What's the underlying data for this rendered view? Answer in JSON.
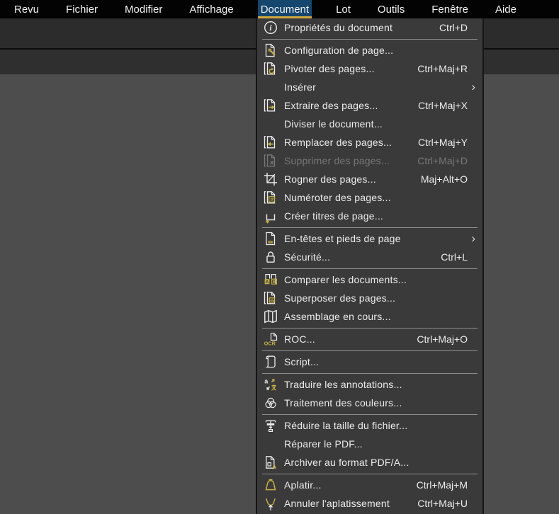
{
  "colors": {
    "menubar_bg": "#030303",
    "active_tab_bg": "#15466e",
    "underline_gold": "#cfa93c",
    "icon_accent": "#c9b041",
    "panel_bg": "#3a3a3a",
    "workspace_bg": "#4d4d4d",
    "text": "#ececec",
    "disabled_text": "#777777",
    "separator": "#8d8d8d"
  },
  "menubar": {
    "items": [
      {
        "label": "Revu"
      },
      {
        "label": "Fichier"
      },
      {
        "label": "Modifier"
      },
      {
        "label": "Affichage"
      },
      {
        "label": "Document",
        "active": true
      },
      {
        "label": "Lot"
      },
      {
        "label": "Outils"
      },
      {
        "label": "Fenêtre"
      },
      {
        "label": "Aide"
      }
    ]
  },
  "dropdown": {
    "owner": "Document",
    "groups": [
      {
        "items": [
          {
            "label": "Propriétés du document",
            "icon": "info-icon",
            "shortcut": "Ctrl+D"
          }
        ]
      },
      {
        "items": [
          {
            "label": "Configuration de page...",
            "icon": "page-setup-icon"
          },
          {
            "label": "Pivoter des pages...",
            "icon": "rotate-pages-icon",
            "shortcut": "Ctrl+Maj+R"
          },
          {
            "label": "Insérer",
            "submenu": true
          },
          {
            "label": "Extraire des pages...",
            "icon": "extract-pages-icon",
            "shortcut": "Ctrl+Maj+X"
          },
          {
            "label": "Diviser le document..."
          },
          {
            "label": "Remplacer des pages...",
            "icon": "replace-pages-icon",
            "shortcut": "Ctrl+Maj+Y"
          },
          {
            "label": "Supprimer des pages...",
            "icon": "delete-pages-icon",
            "shortcut": "Ctrl+Maj+D",
            "disabled": true
          },
          {
            "label": "Rogner des pages...",
            "icon": "crop-pages-icon",
            "shortcut": "Maj+Alt+O"
          },
          {
            "label": "Numéroter des pages...",
            "icon": "number-pages-icon"
          },
          {
            "label": "Créer titres de page...",
            "icon": "page-labels-icon"
          }
        ]
      },
      {
        "items": [
          {
            "label": "En-têtes et pieds de page",
            "icon": "header-footer-icon",
            "submenu": true
          },
          {
            "label": "Sécurité...",
            "icon": "lock-icon",
            "shortcut": "Ctrl+L"
          }
        ]
      },
      {
        "items": [
          {
            "label": "Comparer les documents...",
            "icon": "compare-documents-icon"
          },
          {
            "label": "Superposer des pages...",
            "icon": "overlay-pages-icon"
          },
          {
            "label": "Assemblage en cours...",
            "icon": "assemble-map-icon"
          }
        ]
      },
      {
        "items": [
          {
            "label": "ROC...",
            "icon": "ocr-icon",
            "shortcut": "Ctrl+Maj+O"
          }
        ]
      },
      {
        "items": [
          {
            "label": "Script...",
            "icon": "script-scroll-icon"
          }
        ]
      },
      {
        "items": [
          {
            "label": "Traduire les annotations...",
            "icon": "translate-icon"
          },
          {
            "label": "Traitement des couleurs...",
            "icon": "color-process-icon"
          }
        ]
      },
      {
        "items": [
          {
            "label": "Réduire la taille du fichier...",
            "icon": "reduce-file-size-icon"
          },
          {
            "label": "Réparer le PDF..."
          },
          {
            "label": "Archiver au format PDF/A...",
            "icon": "pdfa-archive-icon"
          }
        ]
      },
      {
        "items": [
          {
            "label": "Aplatir...",
            "icon": "flatten-icon",
            "shortcut": "Ctrl+Maj+M"
          },
          {
            "label": "Annuler l'aplatissement",
            "icon": "unflatten-icon",
            "shortcut": "Ctrl+Maj+U"
          }
        ]
      }
    ]
  }
}
